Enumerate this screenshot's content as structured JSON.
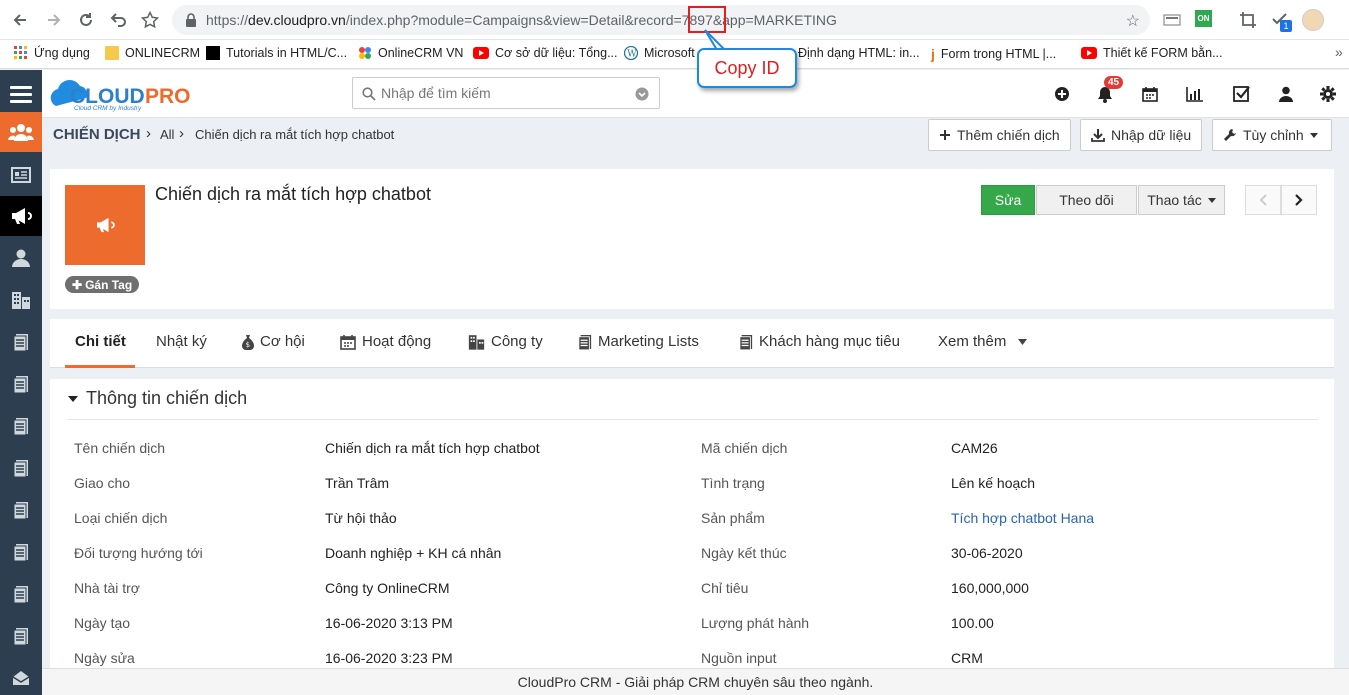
{
  "browser": {
    "url_prefix": "https://",
    "url_host": "dev.cloudpro.vn",
    "url_path": "/index.php?module=Campaigns&view=Detail&record=",
    "url_record": "7897",
    "url_suffix": "&app=MARKETING",
    "ext_badge": "1",
    "ext_on_label": "ON"
  },
  "bookmarks": [
    {
      "label": "Ứng dụng",
      "icon": "apps-grid-icon"
    },
    {
      "label": "ONLINECRM",
      "icon": "folder-icon"
    },
    {
      "label": "Tutorials in HTML/C...",
      "icon": "black-square-icon"
    },
    {
      "label": "OnlineCRM VN",
      "icon": "colorful-dots-icon"
    },
    {
      "label": "Cơ sở dữ liệu: Tổng...",
      "icon": "youtube-icon"
    },
    {
      "label": "Microsoft",
      "icon": "wordpress-icon"
    },
    {
      "label": "Định dạng HTML: in...",
      "icon": "blank-icon"
    },
    {
      "label": "Form trong HTML |...",
      "icon": "j-icon"
    },
    {
      "label": "Thiết kế FORM bằn...",
      "icon": "youtube-icon"
    }
  ],
  "callout": {
    "label": "Copy ID"
  },
  "app": {
    "logo_text_cloud": "CLOUD",
    "logo_text_pro": "PRO",
    "logo_tagline": "Cloud CRM by Industry",
    "search_placeholder": "Nhập để tìm kiếm",
    "notification_count": "45"
  },
  "breadcrumb": {
    "module": "CHIẾN DỊCH",
    "sep": "›",
    "all": "All",
    "record": "Chiến dịch ra mắt tích hợp chatbot"
  },
  "header_buttons": {
    "add": "Thêm chiến dịch",
    "import": "Nhập dữ liệu",
    "customize": "Tùy chỉnh"
  },
  "record": {
    "title": "Chiến dịch ra mắt tích hợp chatbot",
    "tag_button": "Gán Tag",
    "edit": "Sửa",
    "follow": "Theo dõi",
    "actions": "Thao tác"
  },
  "tabs": [
    {
      "label": "Chi tiết",
      "icon": ""
    },
    {
      "label": "Nhật ký",
      "icon": ""
    },
    {
      "label": "Cơ hội",
      "icon": "money-bag-icon"
    },
    {
      "label": "Hoạt động",
      "icon": "calendar-icon"
    },
    {
      "label": "Công ty",
      "icon": "building-icon"
    },
    {
      "label": "Marketing Lists",
      "icon": "document-icon"
    },
    {
      "label": "Khách hàng mục tiêu",
      "icon": "document-icon"
    },
    {
      "label": "Xem thêm",
      "icon": ""
    }
  ],
  "section": {
    "title": "Thông tin chiến dịch",
    "left_fields": [
      {
        "label": "Tên chiến dịch",
        "value": "Chiến dịch ra mắt tích hợp chatbot"
      },
      {
        "label": "Giao cho",
        "value": "Trần Trâm"
      },
      {
        "label": "Loại chiến dịch",
        "value": "Từ hội thảo"
      },
      {
        "label": "Đối tượng hướng tới",
        "value": "Doanh nghiệp + KH cá nhân"
      },
      {
        "label": "Nhà tài trợ",
        "value": "Công ty OnlineCRM"
      },
      {
        "label": "Ngày tạo",
        "value": "16-06-2020 3:13 PM"
      },
      {
        "label": "Ngày sửa",
        "value": "16-06-2020 3:23 PM"
      }
    ],
    "right_fields": [
      {
        "label": "Mã chiến dịch",
        "value": "CAM26"
      },
      {
        "label": "Tình trạng",
        "value": "Lên kế hoạch"
      },
      {
        "label": "Sản phẩm",
        "value": "Tích hợp chatbot Hana"
      },
      {
        "label": "Ngày kết thúc",
        "value": "30-06-2020"
      },
      {
        "label": "Chỉ tiêu",
        "value": "160,000,000"
      },
      {
        "label": "Lượng phát hành",
        "value": "100.00"
      },
      {
        "label": "Nguồn input",
        "value": "CRM"
      }
    ]
  },
  "footer": {
    "text": "CloudPro CRM - Giải pháp CRM chuyên sâu theo ngành."
  },
  "colors": {
    "accent": "#ed6b2c",
    "sidebar": "#2c3e50",
    "edit_button": "#35a94a",
    "link": "#2864b4",
    "callout_text": "#e02020",
    "callout_border": "#1e88e5"
  }
}
